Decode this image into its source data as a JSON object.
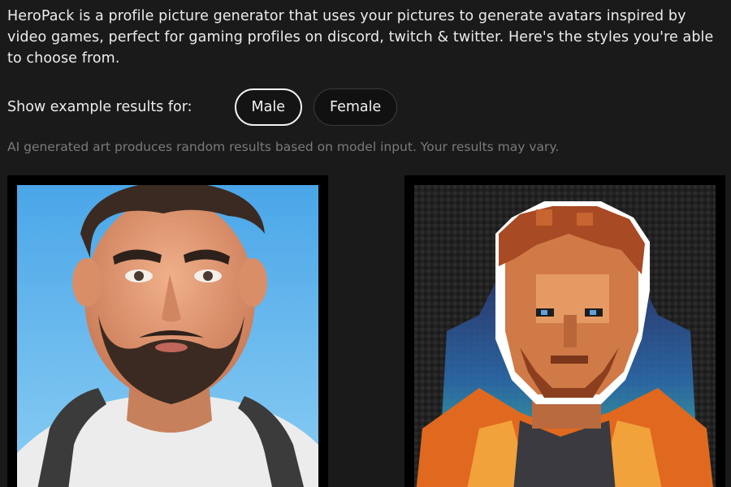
{
  "intro": {
    "text": "HeroPack is a profile picture generator that uses your pictures to generate avatars inspired by video games, perfect for gaming profiles on discord, twitch & twitter. Here's the styles you're able to choose from."
  },
  "filter": {
    "label": "Show example results for:",
    "options": [
      {
        "label": "Male",
        "selected": true
      },
      {
        "label": "Female",
        "selected": false
      }
    ]
  },
  "disclaimer": "AI generated art produces random results based on model input. Your results may vary.",
  "examples": [
    {
      "style": "3d-cartoon-avatar"
    },
    {
      "style": "pixel-art-avatar"
    }
  ],
  "colors": {
    "background": "#1a1a1a",
    "text": "#ececec",
    "muted": "#7a7a7a",
    "card": "#000000"
  }
}
